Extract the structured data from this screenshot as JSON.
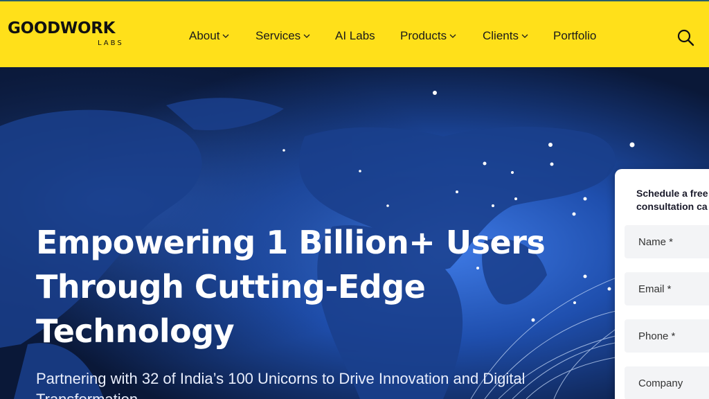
{
  "brand": {
    "name": "GOODWORK",
    "sub": "LABS"
  },
  "nav": {
    "items": [
      {
        "label": "About",
        "has_dropdown": true
      },
      {
        "label": "Services",
        "has_dropdown": true
      },
      {
        "label": "AI Labs",
        "has_dropdown": false
      },
      {
        "label": "Products",
        "has_dropdown": true
      },
      {
        "label": "Clients",
        "has_dropdown": true
      },
      {
        "label": "Portfolio",
        "has_dropdown": false
      }
    ],
    "search_icon": "search-icon"
  },
  "hero": {
    "headline": [
      "Empowering 1 Billion+ Users",
      "Through Cutting-Edge",
      "Technology"
    ],
    "subheadline": "Partnering with 32 of India’s 100 Unicorns to Drive Innovation and Digital Transformation"
  },
  "form": {
    "title_lines": [
      "Schedule a free",
      "consultation ca"
    ],
    "fields": [
      {
        "placeholder": "Name *"
      },
      {
        "placeholder": "Email *"
      },
      {
        "placeholder": "Phone *"
      },
      {
        "placeholder": "Company"
      }
    ]
  },
  "colors": {
    "header_bg": "#ffe01a",
    "hero_bg": "#0b1a3c",
    "text_dark": "#1a1a1a",
    "text_light": "#ffffff"
  }
}
